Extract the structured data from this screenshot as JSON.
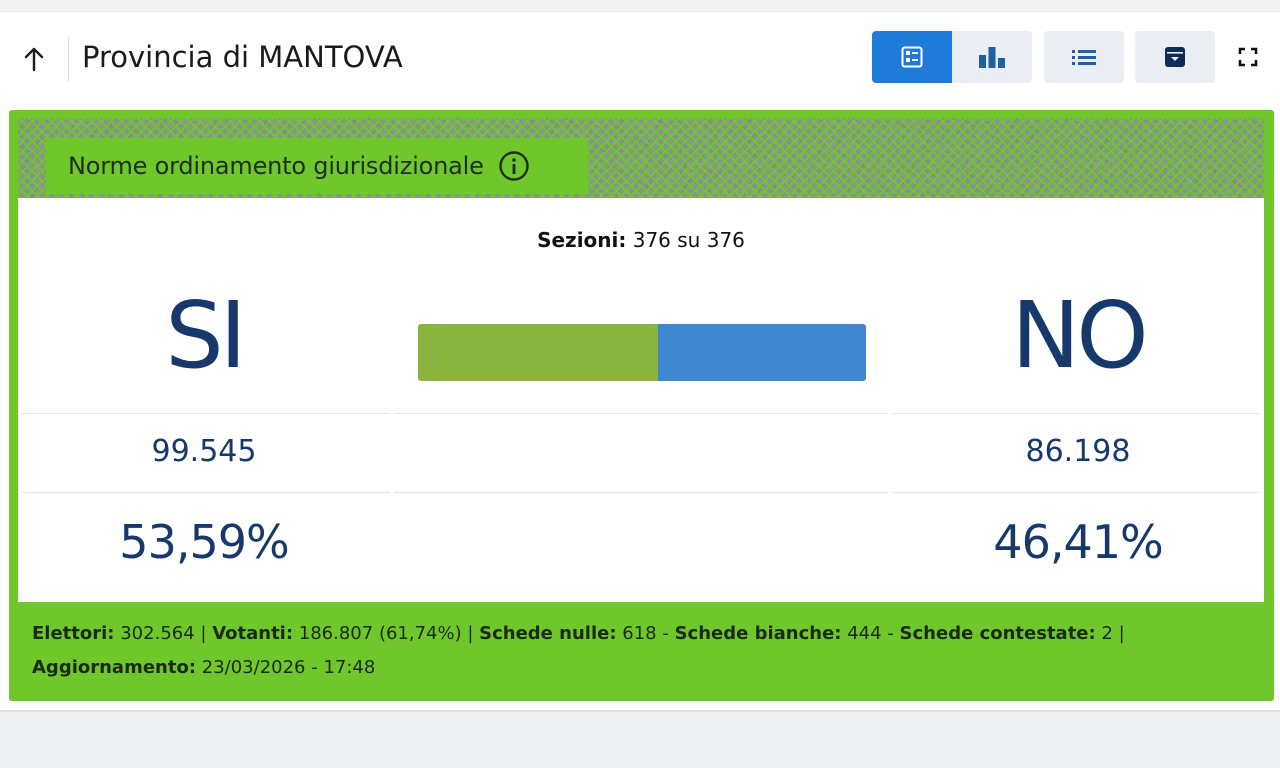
{
  "header": {
    "title": "Provincia di MANTOVA",
    "icons": [
      "arrow-up-icon",
      "cards-view-icon",
      "bar-chart-icon",
      "list-icon",
      "archive-icon",
      "fullscreen-icon"
    ]
  },
  "card": {
    "label": "Norme ordinamento giurisdizionale",
    "sezioni_label": "Sezioni:",
    "sezioni_value": "376 su 376",
    "si": {
      "label": "SI",
      "votes": "99.545",
      "percent": "53,59%",
      "share": 0.5359,
      "color": "#8bb43e"
    },
    "no": {
      "label": "NO",
      "votes": "86.198",
      "percent": "46,41%",
      "share": 0.4641,
      "color": "#3f88cf"
    },
    "accent_color": "#6fc72c"
  },
  "footer": {
    "elettori_label": "Elettori:",
    "elettori_value": "302.564",
    "votanti_label": "Votanti:",
    "votanti_value": "186.807 (61,74%)",
    "nulle_label": "Schede nulle:",
    "nulle_value": "618",
    "bianche_label": "Schede bianche:",
    "bianche_value": "444",
    "contestate_label": "Schede contestate:",
    "contestate_value": "2",
    "aggiornamento_label": "Aggiornamento:",
    "aggiornamento_value": "23/03/2026 - 17:48"
  }
}
